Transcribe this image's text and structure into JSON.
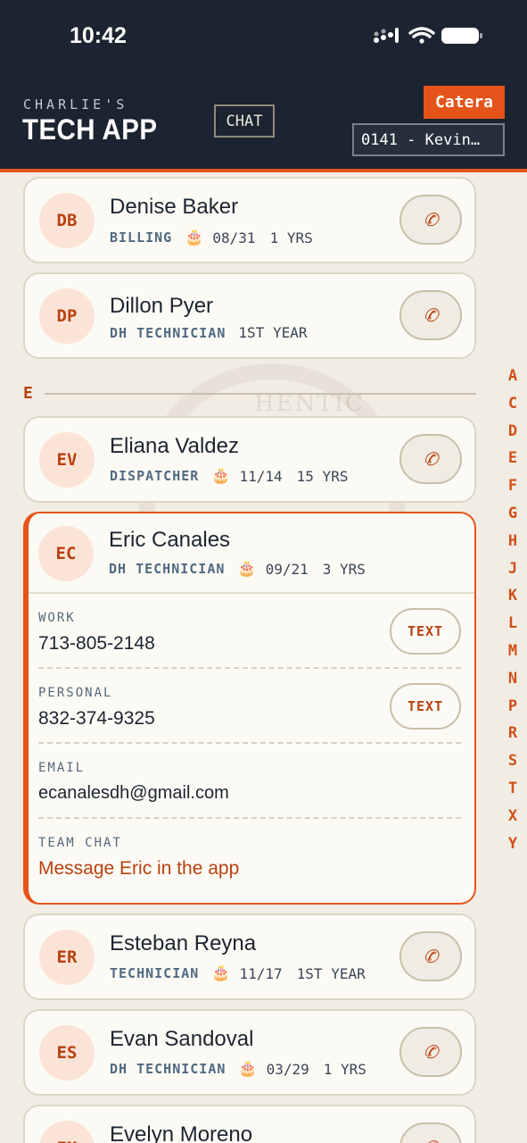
{
  "status": {
    "time": "10:42"
  },
  "header": {
    "brand_small": "CHARLIE'S",
    "brand_big": "TECH APP",
    "chat_label": "CHAT",
    "catera_label": "Catera",
    "account_value": "0141 - Kevin…"
  },
  "contacts": [
    {
      "initials": "DB",
      "name": "Denise Baker",
      "role": "BILLING",
      "birthday": "08/31",
      "tenure": "1 YRS"
    },
    {
      "initials": "DP",
      "name": "Dillon Pyer",
      "role": "DH TECHNICIAN",
      "birthday": "",
      "tenure": "1ST YEAR"
    },
    {
      "initials": "EV",
      "name": "Eliana Valdez",
      "role": "DISPATCHER",
      "birthday": "11/14",
      "tenure": "15 YRS"
    },
    {
      "initials": "EC",
      "name": "Eric Canales",
      "role": "DH TECHNICIAN",
      "birthday": "09/21",
      "tenure": "3 YRS"
    },
    {
      "initials": "ER",
      "name": "Esteban Reyna",
      "role": "TECHNICIAN",
      "birthday": "11/17",
      "tenure": "1ST YEAR"
    },
    {
      "initials": "ES",
      "name": "Evan Sandoval",
      "role": "DH TECHNICIAN",
      "birthday": "03/29",
      "tenure": "1 YRS"
    },
    {
      "initials": "EM",
      "name": "Evelyn Moreno"
    }
  ],
  "section_letter": "E",
  "expanded": {
    "work_label": "WORK",
    "work_value": "713-805-2148",
    "personal_label": "PERSONAL",
    "personal_value": "832-374-9325",
    "email_label": "EMAIL",
    "email_value": "ecanalesdh@gmail.com",
    "team_chat_label": "TEAM CHAT",
    "team_chat_link": "Message Eric in the app",
    "text_button": "TEXT"
  },
  "alpha_index": [
    "A",
    "C",
    "D",
    "E",
    "F",
    "G",
    "H",
    "J",
    "K",
    "L",
    "M",
    "N",
    "P",
    "R",
    "S",
    "T",
    "X",
    "Y"
  ],
  "icons": {
    "cake": "🎂",
    "phone": "✆"
  }
}
